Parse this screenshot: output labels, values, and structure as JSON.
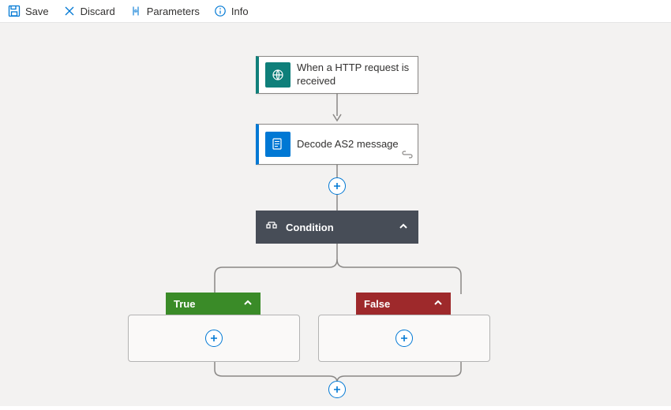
{
  "toolbar": {
    "save_label": "Save",
    "discard_label": "Discard",
    "parameters_label": "Parameters",
    "info_label": "Info"
  },
  "nodes": {
    "http_trigger": {
      "label": "When a HTTP request is received"
    },
    "decode_as2": {
      "label": "Decode AS2 message"
    },
    "condition": {
      "label": "Condition"
    }
  },
  "branches": {
    "true_label": "True",
    "false_label": "False"
  },
  "colors": {
    "azure_blue": "#0078d4",
    "teal": "#0f7f7a",
    "condition_bg": "#474d57",
    "true_bg": "#3a8b28",
    "false_bg": "#9e292b"
  }
}
